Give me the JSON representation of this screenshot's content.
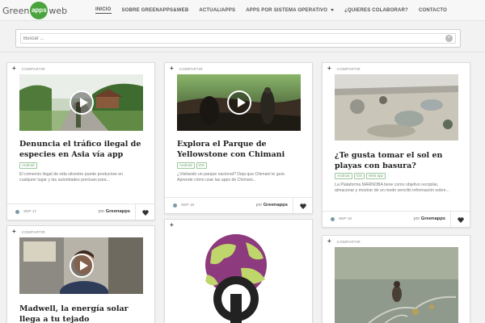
{
  "logo": {
    "left": "Green",
    "badge": "apps",
    "right": "web"
  },
  "nav": [
    {
      "label": "INICIO",
      "active": true
    },
    {
      "label": "SOBRE GREENAPPS&WEB"
    },
    {
      "label": "ACTUALIAPPS"
    },
    {
      "label": "APPS POR SISTEMA OPERATIVO"
    },
    {
      "label": "¿QUIERES COLABORAR?"
    },
    {
      "label": "CONTACTO"
    }
  ],
  "search": {
    "placeholder": "Buscar ...",
    "clear_glyph": "×"
  },
  "share_label": "COMPARTIR",
  "plus_glyph": "+",
  "by_label": "por",
  "author": "Greenapps",
  "cards": [
    {
      "title": "Denuncia el tráfico ilegal de especies en Asia vía app",
      "tags": [
        "Android"
      ],
      "excerpt": "El comercio ilegal de vida silvestre puede producirse en cualquier lugar y las autoridades precisan para...",
      "date": "SEP 17"
    },
    {
      "title": "Explora el Parque de Yellowstone con Chimani",
      "tags": [
        "Android",
        "iOS"
      ],
      "excerpt": "¿Visitando un parque nacional? Deja que Chimani te guíe. Aprende cómo usar las apps de Chimani...",
      "date": "SEP 15"
    },
    {
      "title": "¿Te gusta tomar el sol en playas con basura?",
      "tags": [
        "Android",
        "iOS",
        "Web app"
      ],
      "excerpt": "La Plataforma MARNOBA tiene como objetivo recopilar, almacenar y mostrar de un modo sencillo información sobre...",
      "date": "SEP 10"
    },
    {
      "title": "Madwell, la energía solar llega a tu tejado"
    }
  ],
  "icons": {
    "like": "heart-icon",
    "date": "clock-icon",
    "play": "play-icon"
  }
}
